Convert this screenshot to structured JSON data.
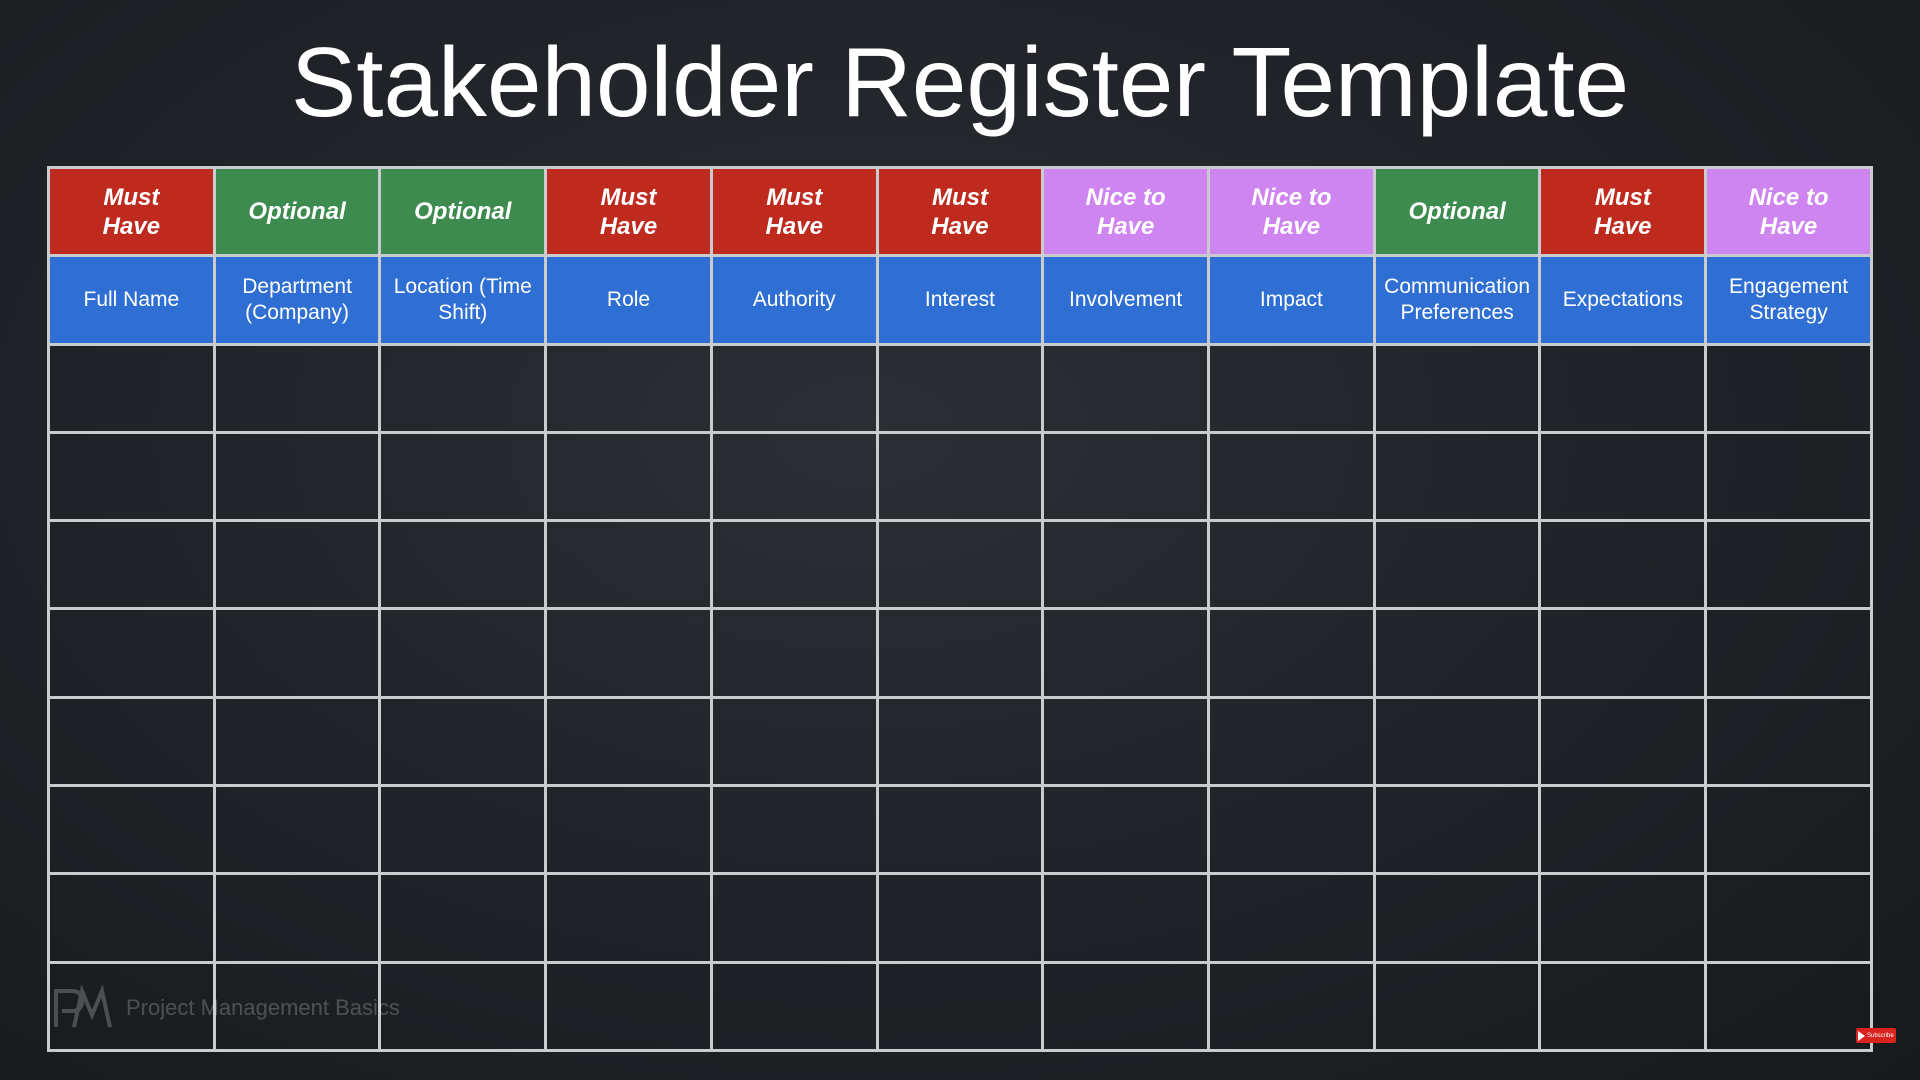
{
  "title": "Stakeholder Register Template",
  "colors": {
    "must_have": "#bf2a1f",
    "optional": "#3e8b4f",
    "nice_to_have": "#cf85f0",
    "header": "#2f6fd3",
    "grid": "#c9cbce",
    "background": "#212429"
  },
  "columns": [
    {
      "priority": "Must Have",
      "priority_level": "must",
      "header": "Full Name"
    },
    {
      "priority": "Optional",
      "priority_level": "optional",
      "header": "Department (Company)"
    },
    {
      "priority": "Optional",
      "priority_level": "optional",
      "header": "Location (Time Shift)"
    },
    {
      "priority": "Must Have",
      "priority_level": "must",
      "header": "Role"
    },
    {
      "priority": "Must Have",
      "priority_level": "must",
      "header": "Authority"
    },
    {
      "priority": "Must Have",
      "priority_level": "must",
      "header": "Interest"
    },
    {
      "priority": "Nice to Have",
      "priority_level": "nice",
      "header": "Involvement"
    },
    {
      "priority": "Nice to Have",
      "priority_level": "nice",
      "header": "Impact"
    },
    {
      "priority": "Optional",
      "priority_level": "optional",
      "header": "Communication Preferences"
    },
    {
      "priority": "Must Have",
      "priority_level": "must",
      "header": "Expectations"
    },
    {
      "priority": "Nice to Have",
      "priority_level": "nice",
      "header": "Engagement Strategy"
    }
  ],
  "empty_rows": 8,
  "watermark": {
    "logo_icon": "pm-logo-icon",
    "text": "Project Management Basics"
  },
  "subscribe_badge": {
    "icon": "play-icon",
    "text": "Subscribe"
  }
}
